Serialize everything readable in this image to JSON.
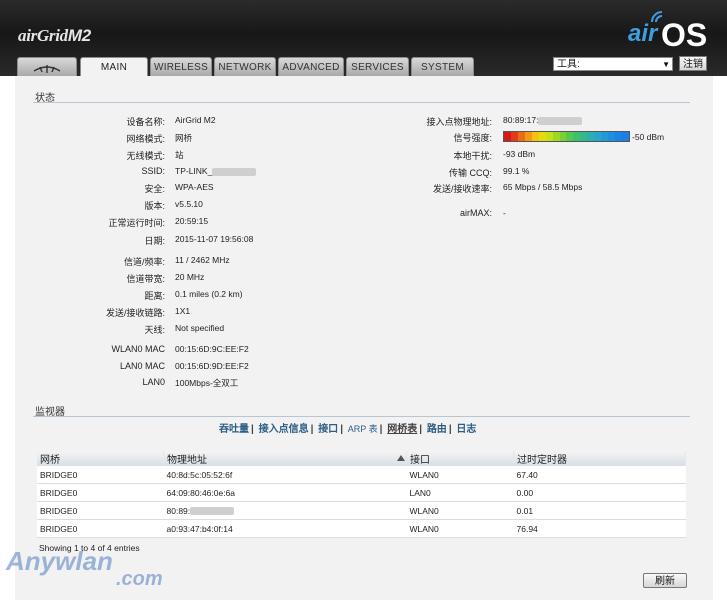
{
  "header": {
    "brand_left": "airGrid",
    "brand_left_model": "M2",
    "brand_right_air": "air",
    "brand_right_os": "OS",
    "tools_select_value": "工具:",
    "logout_label": "注销"
  },
  "tabs": [
    {
      "label": "MAIN",
      "active": true
    },
    {
      "label": "WIRELESS"
    },
    {
      "label": "NETWORK"
    },
    {
      "label": "ADVANCED"
    },
    {
      "label": "SERVICES"
    },
    {
      "label": "SYSTEM"
    }
  ],
  "status": {
    "title": "状态",
    "left": [
      {
        "label": "设备名称:",
        "value": "AirGrid M2"
      },
      {
        "label": "网络模式:",
        "value": "网桥"
      },
      {
        "label": "无线模式:",
        "value": "站"
      },
      {
        "label": "SSID:",
        "value": "TP-LINK_"
      },
      {
        "label": "安全:",
        "value": "WPA-AES"
      },
      {
        "label": "版本:",
        "value": "v5.5.10"
      },
      {
        "label": "正常运行时间:",
        "value": "20:59:15"
      },
      {
        "label": "日期:",
        "value": "2015-11-07 19:56:08"
      },
      {
        "label": "信道/频率:",
        "value": "11 / 2462 MHz"
      },
      {
        "label": "信道带宽:",
        "value": "20 MHz"
      },
      {
        "label": "距离:",
        "value": "0.1 miles (0.2 km)"
      },
      {
        "label": "发送/接收链路:",
        "value": "1X1"
      },
      {
        "label": "天线:",
        "value": "Not specified"
      },
      {
        "label": "WLAN0 MAC",
        "value": "00:15:6D:9C:EE:F2"
      },
      {
        "label": "LAN0 MAC",
        "value": "00:15:6D:9D:EE:F2"
      },
      {
        "label": "LAN0",
        "value": "100Mbps-全双工"
      }
    ],
    "right": [
      {
        "label": "接入点物理地址:",
        "value": "80:89:17:"
      },
      {
        "label": "信号强度:",
        "value": "-50 dBm"
      },
      {
        "label": "本地干扰:",
        "value": "-93 dBm"
      },
      {
        "label": "传输 CCQ:",
        "value": "99.1 %"
      },
      {
        "label": "发送/接收速率:",
        "value": "65 Mbps / 58.5 Mbps"
      },
      {
        "label": "airMAX:",
        "value": "-"
      }
    ]
  },
  "monitor": {
    "title": "监视器",
    "links": [
      "吞吐量",
      "接入点信息",
      "接口",
      "ARP 表",
      "网桥表",
      "路由",
      "日志"
    ],
    "table": {
      "headers": [
        "网桥",
        "物理地址",
        "接口",
        "过时定时器"
      ],
      "rows": [
        [
          "BRIDGE0",
          "40:8d:5c:05:52:6f",
          "WLAN0",
          "67.40"
        ],
        [
          "BRIDGE0",
          "64:09:80:46:0e:6a",
          "LAN0",
          "0.00"
        ],
        [
          "BRIDGE0",
          "80:89:",
          "WLAN0",
          "0.01"
        ],
        [
          "BRIDGE0",
          "a0:93:47:b4:0f:14",
          "WLAN0",
          "76.94"
        ]
      ]
    },
    "showing": "Showing 1 to 4 of 4 entries",
    "refresh_label": "刷新"
  },
  "watermark": {
    "line1": "Anywlan",
    "line2": ".com"
  },
  "colors": {
    "signal": [
      "#d41b1b",
      "#e33a1a",
      "#ee6a16",
      "#f29a12",
      "#f5c20f",
      "#e5dc10",
      "#c6e018",
      "#9fd824",
      "#7bd036",
      "#58c84a",
      "#3fc06a",
      "#34b88c",
      "#2cb0ad",
      "#27a6c8",
      "#229ad8",
      "#1e8fe0",
      "#1a84e6",
      "#1a7ee8"
    ],
    "accent": "#3e9fe0",
    "link": "#2c5d86"
  }
}
